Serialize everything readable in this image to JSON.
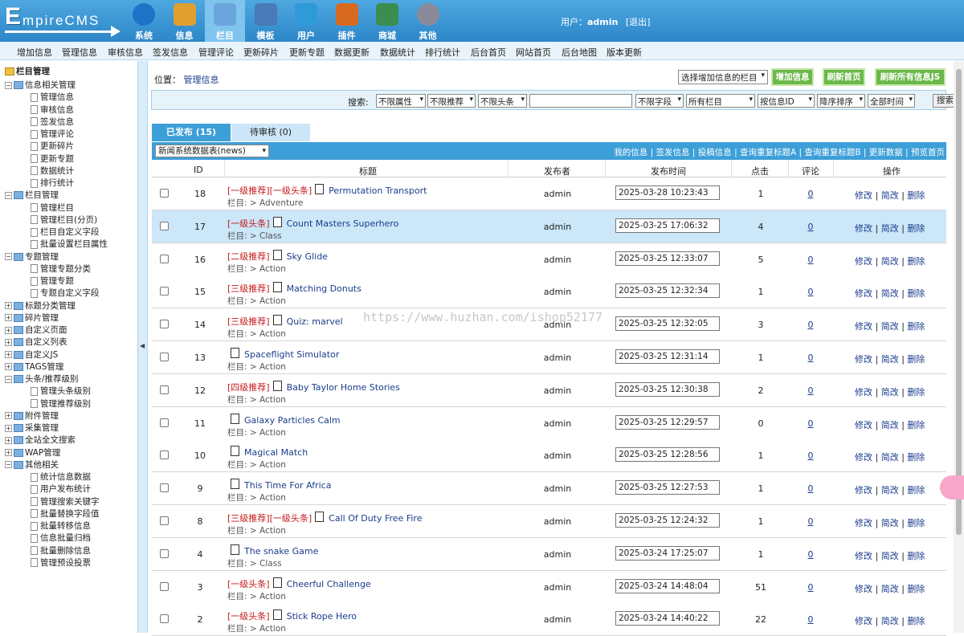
{
  "header": {
    "logo": "EmpireCMS",
    "nav": [
      "系统",
      "信息",
      "栏目",
      "模板",
      "用户",
      "插件",
      "商城",
      "其他"
    ],
    "active_nav": "栏目",
    "user_label": "用户：",
    "user_name": "admin",
    "logout": "[退出]"
  },
  "menubar": [
    "增加信息",
    "管理信息",
    "审核信息",
    "签发信息",
    "管理评论",
    "更新碎片",
    "更新专题",
    "数据更新",
    "数据统计",
    "排行统计",
    "后台首页",
    "网站首页",
    "后台地图",
    "版本更新"
  ],
  "sidebar": {
    "root": "栏目管理",
    "tree": [
      {
        "label": "信息相关管理",
        "type": "folder",
        "open": true
      },
      {
        "label": "管理信息",
        "type": "doc"
      },
      {
        "label": "审核信息",
        "type": "doc"
      },
      {
        "label": "签发信息",
        "type": "doc"
      },
      {
        "label": "管理评论",
        "type": "doc"
      },
      {
        "label": "更新碎片",
        "type": "doc"
      },
      {
        "label": "更新专题",
        "type": "doc"
      },
      {
        "label": "数据统计",
        "type": "doc"
      },
      {
        "label": "排行统计",
        "type": "doc"
      },
      {
        "label": "栏目管理",
        "type": "folder",
        "open": true
      },
      {
        "label": "管理栏目",
        "type": "doc"
      },
      {
        "label": "管理栏目(分页)",
        "type": "doc"
      },
      {
        "label": "栏目自定义字段",
        "type": "doc"
      },
      {
        "label": "批量设置栏目属性",
        "type": "doc"
      },
      {
        "label": "专题管理",
        "type": "folder",
        "open": true
      },
      {
        "label": "管理专题分类",
        "type": "doc"
      },
      {
        "label": "管理专题",
        "type": "doc"
      },
      {
        "label": "专题自定义字段",
        "type": "doc"
      },
      {
        "label": "标题分类管理",
        "type": "folder",
        "open": false
      },
      {
        "label": "碎片管理",
        "type": "folder",
        "open": false
      },
      {
        "label": "自定义页面",
        "type": "folder",
        "open": false
      },
      {
        "label": "自定义列表",
        "type": "folder",
        "open": false
      },
      {
        "label": "自定义JS",
        "type": "folder",
        "open": false
      },
      {
        "label": "TAGS管理",
        "type": "folder",
        "open": false
      },
      {
        "label": "头条/推荐级别",
        "type": "folder",
        "open": true
      },
      {
        "label": "管理头条级别",
        "type": "doc"
      },
      {
        "label": "管理推荐级别",
        "type": "doc"
      },
      {
        "label": "附件管理",
        "type": "folder",
        "open": false
      },
      {
        "label": "采集管理",
        "type": "folder",
        "open": false
      },
      {
        "label": "全站全文搜索",
        "type": "folder",
        "open": false
      },
      {
        "label": "WAP管理",
        "type": "folder",
        "open": false
      },
      {
        "label": "其他相关",
        "type": "folder",
        "open": true
      },
      {
        "label": "统计信息数据",
        "type": "doc"
      },
      {
        "label": "用户发布统计",
        "type": "doc"
      },
      {
        "label": "管理搜索关键字",
        "type": "doc"
      },
      {
        "label": "批量替换字段值",
        "type": "doc"
      },
      {
        "label": "批量转移信息",
        "type": "doc"
      },
      {
        "label": "信息批量归档",
        "type": "doc"
      },
      {
        "label": "批量删除信息",
        "type": "doc"
      },
      {
        "label": "管理预设投票",
        "type": "doc"
      }
    ]
  },
  "main": {
    "location_label": "位置：",
    "location_link": "管理信息",
    "column_select": "选择增加信息的栏目",
    "buttons": [
      "增加信息",
      "刷新首页",
      "刷新所有信息JS"
    ],
    "search": {
      "label": "搜索:",
      "selects": [
        "不限属性",
        "不限推荐",
        "不限头条",
        "不限字段",
        "所有栏目",
        "按信息ID",
        "降序排序",
        "全部时间"
      ],
      "value": "",
      "button": "搜索"
    },
    "tabs": [
      "已发布 (15)",
      "待审核 (0)"
    ],
    "table_select": "新闻系统数据表(news)",
    "tool_links": [
      "我的信息",
      "签发信息",
      "投稿信息",
      "查询重复标题A",
      "查询重复标题B",
      "更新数据",
      "预览首页"
    ],
    "columns": [
      "ID",
      "标题",
      "发布者",
      "发布时间",
      "点击",
      "评论",
      "操作"
    ],
    "column_prefix": "栏目: > ",
    "ops": [
      "修改",
      "简改",
      "删除"
    ],
    "rows": [
      {
        "id": "18",
        "flag": "[一级推荐][一级头条]",
        "title": "Permutation Transport",
        "column": "Adventure",
        "publisher": "admin",
        "time": "2025-03-28 10:23:43",
        "clicks": "1",
        "comments": "0",
        "highlight": false
      },
      {
        "id": "17",
        "flag": "[一级头条]",
        "title": "Count Masters Superhero",
        "column": "Class",
        "publisher": "admin",
        "time": "2025-03-25 17:06:32",
        "clicks": "4",
        "comments": "0",
        "highlight": true
      },
      {
        "id": "16",
        "flag": "[二级推荐]",
        "title": "Sky Glide",
        "column": "Action",
        "publisher": "admin",
        "time": "2025-03-25 12:33:07",
        "clicks": "5",
        "comments": "0",
        "highlight": false
      },
      {
        "id": "15",
        "flag": "[三级推荐]",
        "title": "Matching Donuts",
        "column": "Action",
        "publisher": "admin",
        "time": "2025-03-25 12:32:34",
        "clicks": "1",
        "comments": "0",
        "highlight": false
      },
      {
        "id": "14",
        "flag": "[三级推荐]",
        "title": "Quiz: marvel",
        "column": "Action",
        "publisher": "admin",
        "time": "2025-03-25 12:32:05",
        "clicks": "3",
        "comments": "0",
        "highlight": false
      },
      {
        "id": "13",
        "flag": "",
        "title": "Spaceflight Simulator",
        "column": "Action",
        "publisher": "admin",
        "time": "2025-03-25 12:31:14",
        "clicks": "1",
        "comments": "0",
        "highlight": false
      },
      {
        "id": "12",
        "flag": "[四级推荐]",
        "title": "Baby Taylor Home Stories",
        "column": "Action",
        "publisher": "admin",
        "time": "2025-03-25 12:30:38",
        "clicks": "2",
        "comments": "0",
        "highlight": false
      },
      {
        "id": "11",
        "flag": "",
        "title": "Galaxy Particles Calm",
        "column": "Action",
        "publisher": "admin",
        "time": "2025-03-25 12:29:57",
        "clicks": "0",
        "comments": "0",
        "highlight": false
      },
      {
        "id": "10",
        "flag": "",
        "title": "Magical Match",
        "column": "Action",
        "publisher": "admin",
        "time": "2025-03-25 12:28:56",
        "clicks": "1",
        "comments": "0",
        "highlight": false
      },
      {
        "id": "9",
        "flag": "",
        "title": "This Time For Africa",
        "column": "Action",
        "publisher": "admin",
        "time": "2025-03-25 12:27:53",
        "clicks": "1",
        "comments": "0",
        "highlight": false
      },
      {
        "id": "8",
        "flag": "[三级推荐][一级头条]",
        "title": "Call Of Duty Free Fire",
        "column": "Action",
        "publisher": "admin",
        "time": "2025-03-25 12:24:32",
        "clicks": "1",
        "comments": "0",
        "highlight": false
      },
      {
        "id": "4",
        "flag": "",
        "title": "The snake Game",
        "column": "Class",
        "publisher": "admin",
        "time": "2025-03-24 17:25:07",
        "clicks": "1",
        "comments": "0",
        "highlight": false
      },
      {
        "id": "3",
        "flag": "[一级头条]",
        "title": "Cheerful Challenge",
        "column": "Action",
        "publisher": "admin",
        "time": "2025-03-24 14:48:04",
        "clicks": "51",
        "comments": "0",
        "highlight": false
      },
      {
        "id": "2",
        "flag": "[一级头条]",
        "title": "Stick Rope Hero",
        "column": "Action",
        "publisher": "admin",
        "time": "2025-03-24 14:40:22",
        "clicks": "22",
        "comments": "0",
        "highlight": false
      }
    ]
  },
  "watermark": "https://www.huzhan.com/ishop52177",
  "colors": {
    "header": "#2c86c8",
    "accent": "#3d9fd8",
    "flag": "#c41a1a",
    "green_button": "#6bb84a",
    "row_highlight": "#cbe7f8"
  }
}
